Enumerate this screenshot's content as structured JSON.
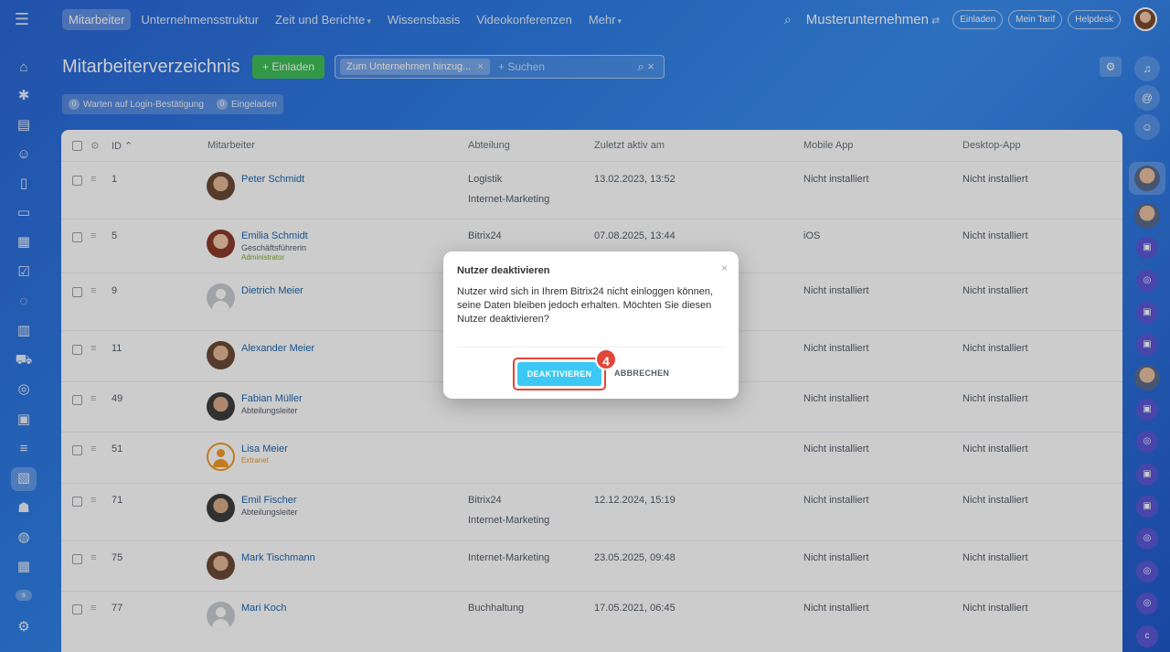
{
  "topnav": {
    "items": [
      {
        "label": "Mitarbeiter",
        "active": true
      },
      {
        "label": "Unternehmensstruktur"
      },
      {
        "label": "Zeit und Berichte",
        "dropdown": true
      },
      {
        "label": "Wissensbasis"
      },
      {
        "label": "Videokonferenzen"
      },
      {
        "label": "Mehr",
        "dropdown": true
      }
    ],
    "company": "Musterunternehmen",
    "pills": [
      "Einladen",
      "Mein Tarif",
      "Helpdesk"
    ]
  },
  "header": {
    "title": "Mitarbeiterverzeichnis",
    "invite_label": "+ Einladen",
    "filter_tag": "Zum Unternehmen hinzug...",
    "search_placeholder": "+ Suchen",
    "counters": [
      {
        "num": "0",
        "label": "Warten auf Login-Bestätigung"
      },
      {
        "num": "0",
        "label": "Eingeladen"
      }
    ]
  },
  "table": {
    "columns": {
      "id": "ID",
      "employee": "Mitarbeiter",
      "department": "Abteilung",
      "last_active": "Zuletzt aktiv am",
      "mobile": "Mobile App",
      "desktop": "Desktop-App"
    },
    "rows": [
      {
        "id": "1",
        "name": "Peter Schmidt",
        "subtitle": "",
        "role": "",
        "dept1": "Logistik",
        "dept2": "Internet-Marketing",
        "last": "13.02.2023, 13:52",
        "mobile": "Nicht installiert",
        "desktop": "Nicht installiert"
      },
      {
        "id": "5",
        "name": "Emilia Schmidt",
        "subtitle": "Geschäftsführerin",
        "role": "Administrator",
        "dept1": "Bitrix24",
        "dept2": "",
        "last": "07.08.2025, 13:44",
        "mobile": "iOS",
        "desktop": "Nicht installiert"
      },
      {
        "id": "9",
        "name": "Dietrich Meier",
        "subtitle": "",
        "role": "",
        "dept1": "",
        "dept2": "",
        "last": "",
        "mobile": "Nicht installiert",
        "desktop": "Nicht installiert"
      },
      {
        "id": "11",
        "name": "Alexander Meier",
        "subtitle": "",
        "role": "",
        "dept1": "",
        "dept2": "",
        "last": "",
        "mobile": "Nicht installiert",
        "desktop": "Nicht installiert"
      },
      {
        "id": "49",
        "name": "Fabian Müller",
        "subtitle": "Abteilungsleiter",
        "role": "",
        "dept1": "",
        "dept2": "",
        "last": "",
        "mobile": "Nicht installiert",
        "desktop": "Nicht installiert"
      },
      {
        "id": "51",
        "name": "Lisa Meier",
        "subtitle": "",
        "role": "Extranet",
        "dept1": "",
        "dept2": "",
        "last": "",
        "mobile": "Nicht installiert",
        "desktop": "Nicht installiert"
      },
      {
        "id": "71",
        "name": "Emil Fischer",
        "subtitle": "Abteilungsleiter",
        "role": "",
        "dept1": "Bitrix24",
        "dept2": "Internet-Marketing",
        "last": "12.12.2024, 15:19",
        "mobile": "Nicht installiert",
        "desktop": "Nicht installiert"
      },
      {
        "id": "75",
        "name": "Mark Tischmann",
        "subtitle": "",
        "role": "",
        "dept1": "Internet-Marketing",
        "dept2": "",
        "last": "23.05.2025, 09:48",
        "mobile": "Nicht installiert",
        "desktop": "Nicht installiert"
      },
      {
        "id": "77",
        "name": "Mari Koch",
        "subtitle": "",
        "role": "",
        "dept1": "Buchhaltung",
        "dept2": "",
        "last": "17.05.2021, 06:45",
        "mobile": "Nicht installiert",
        "desktop": "Nicht installiert"
      }
    ]
  },
  "modal": {
    "title": "Nutzer deaktivieren",
    "text": "Nutzer wird sich in Ihrem Bitrix24 nicht einloggen können, seine Daten bleiben jedoch erhalten. Möchten Sie diesen Nutzer deaktivieren?",
    "confirm_label": "DEAKTIVIEREN",
    "cancel_label": "ABBRECHEN",
    "step": "4"
  },
  "colors": {
    "accent": "#3bc8f5",
    "green": "#3fbf58",
    "highlight": "#e0463a",
    "link": "#2067b0"
  }
}
